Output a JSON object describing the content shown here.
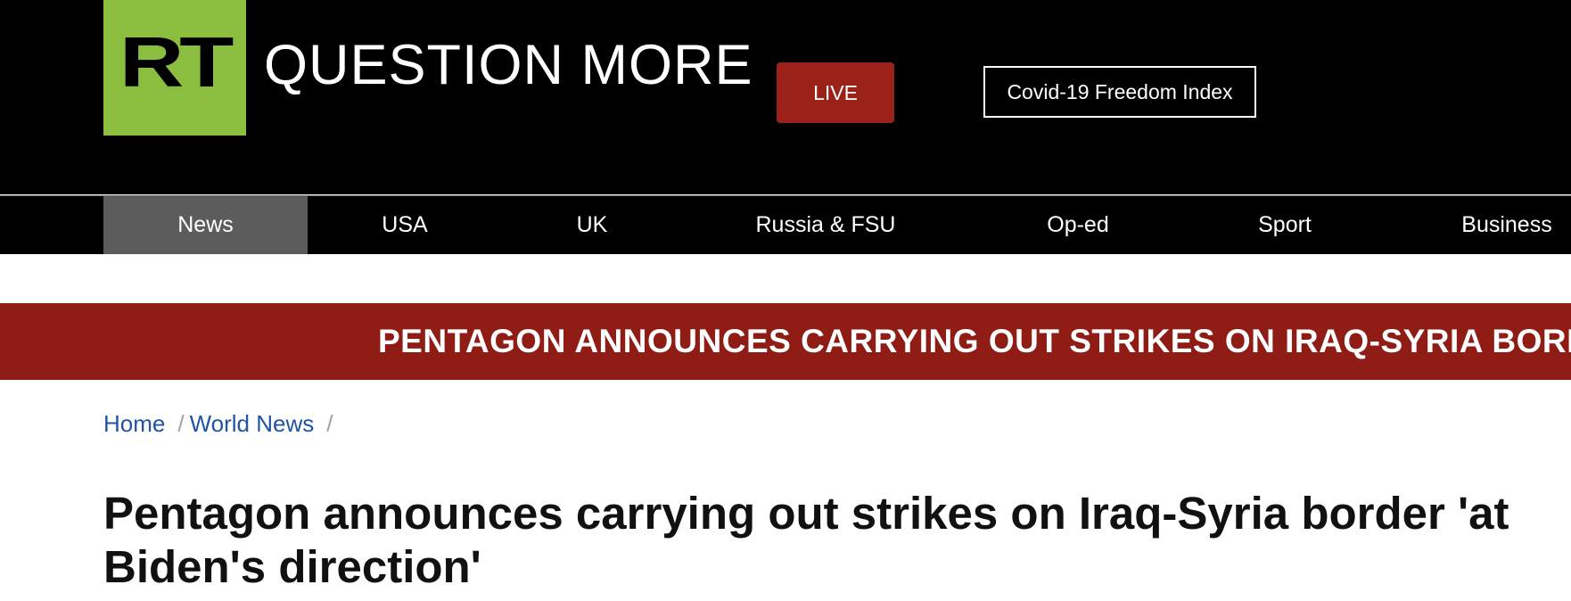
{
  "header": {
    "logo_text": "RT",
    "tagline": "QUESTION MORE",
    "live_label": "LIVE",
    "covid_label": "Covid-19 Freedom Index"
  },
  "nav": {
    "items": [
      {
        "label": "News",
        "active": true
      },
      {
        "label": "USA",
        "active": false
      },
      {
        "label": "UK",
        "active": false
      },
      {
        "label": "Russia & FSU",
        "active": false
      },
      {
        "label": "Op-ed",
        "active": false
      },
      {
        "label": "Sport",
        "active": false
      },
      {
        "label": "Business",
        "active": false
      }
    ]
  },
  "breaking": {
    "text": "PENTAGON ANNOUNCES CARRYING OUT STRIKES ON IRAQ-SYRIA BORDER"
  },
  "breadcrumb": {
    "items": [
      "Home",
      "World News"
    ],
    "separator": "/"
  },
  "article": {
    "headline": "Pentagon announces carrying out strikes on Iraq-Syria border 'at Biden's direction'"
  },
  "colors": {
    "brand_green": "#8bbd3f",
    "live_red": "#9b2219",
    "breaking_red": "#8f1c15",
    "link_blue": "#1f54a3",
    "nav_active": "#5c5c5c"
  }
}
